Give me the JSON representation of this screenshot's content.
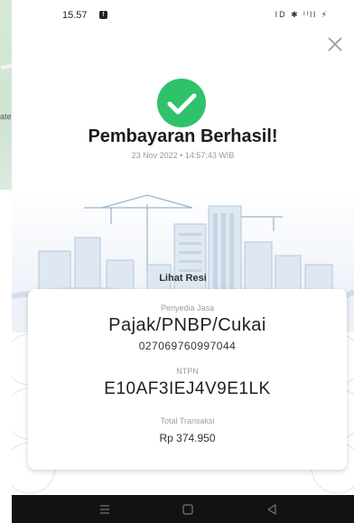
{
  "background_map": {
    "label": "ate"
  },
  "status_bar": {
    "time": "15.57",
    "notification_icon": "f",
    "system_icons": "ID ✱ ᴵᴵll ⚡"
  },
  "header": {
    "close_icon": "close-icon"
  },
  "success": {
    "icon": "check-circle-icon",
    "title": "Pembayaran Berhasil!",
    "datetime": "23 Nov 2022 • 14:57:43 WIB",
    "link": "Lihat Resi"
  },
  "receipt": {
    "provider_label": "Penyedia Jasa",
    "provider": "Pajak/PNBP/Cukai",
    "billing_code": "027069760997044",
    "ntpn_label": "NTPN",
    "ntpn": "E10AF3IEJ4V9E1LK",
    "total_label": "Total Transaksi",
    "total": "Rp 374.950"
  },
  "navigation": {
    "items": [
      "menu-icon",
      "home-icon",
      "back-icon"
    ]
  },
  "colors": {
    "success_green": "#2fc26b",
    "card_bg": "#ffffff",
    "pattern": "#e6edf6",
    "nav_bg": "#121212"
  }
}
